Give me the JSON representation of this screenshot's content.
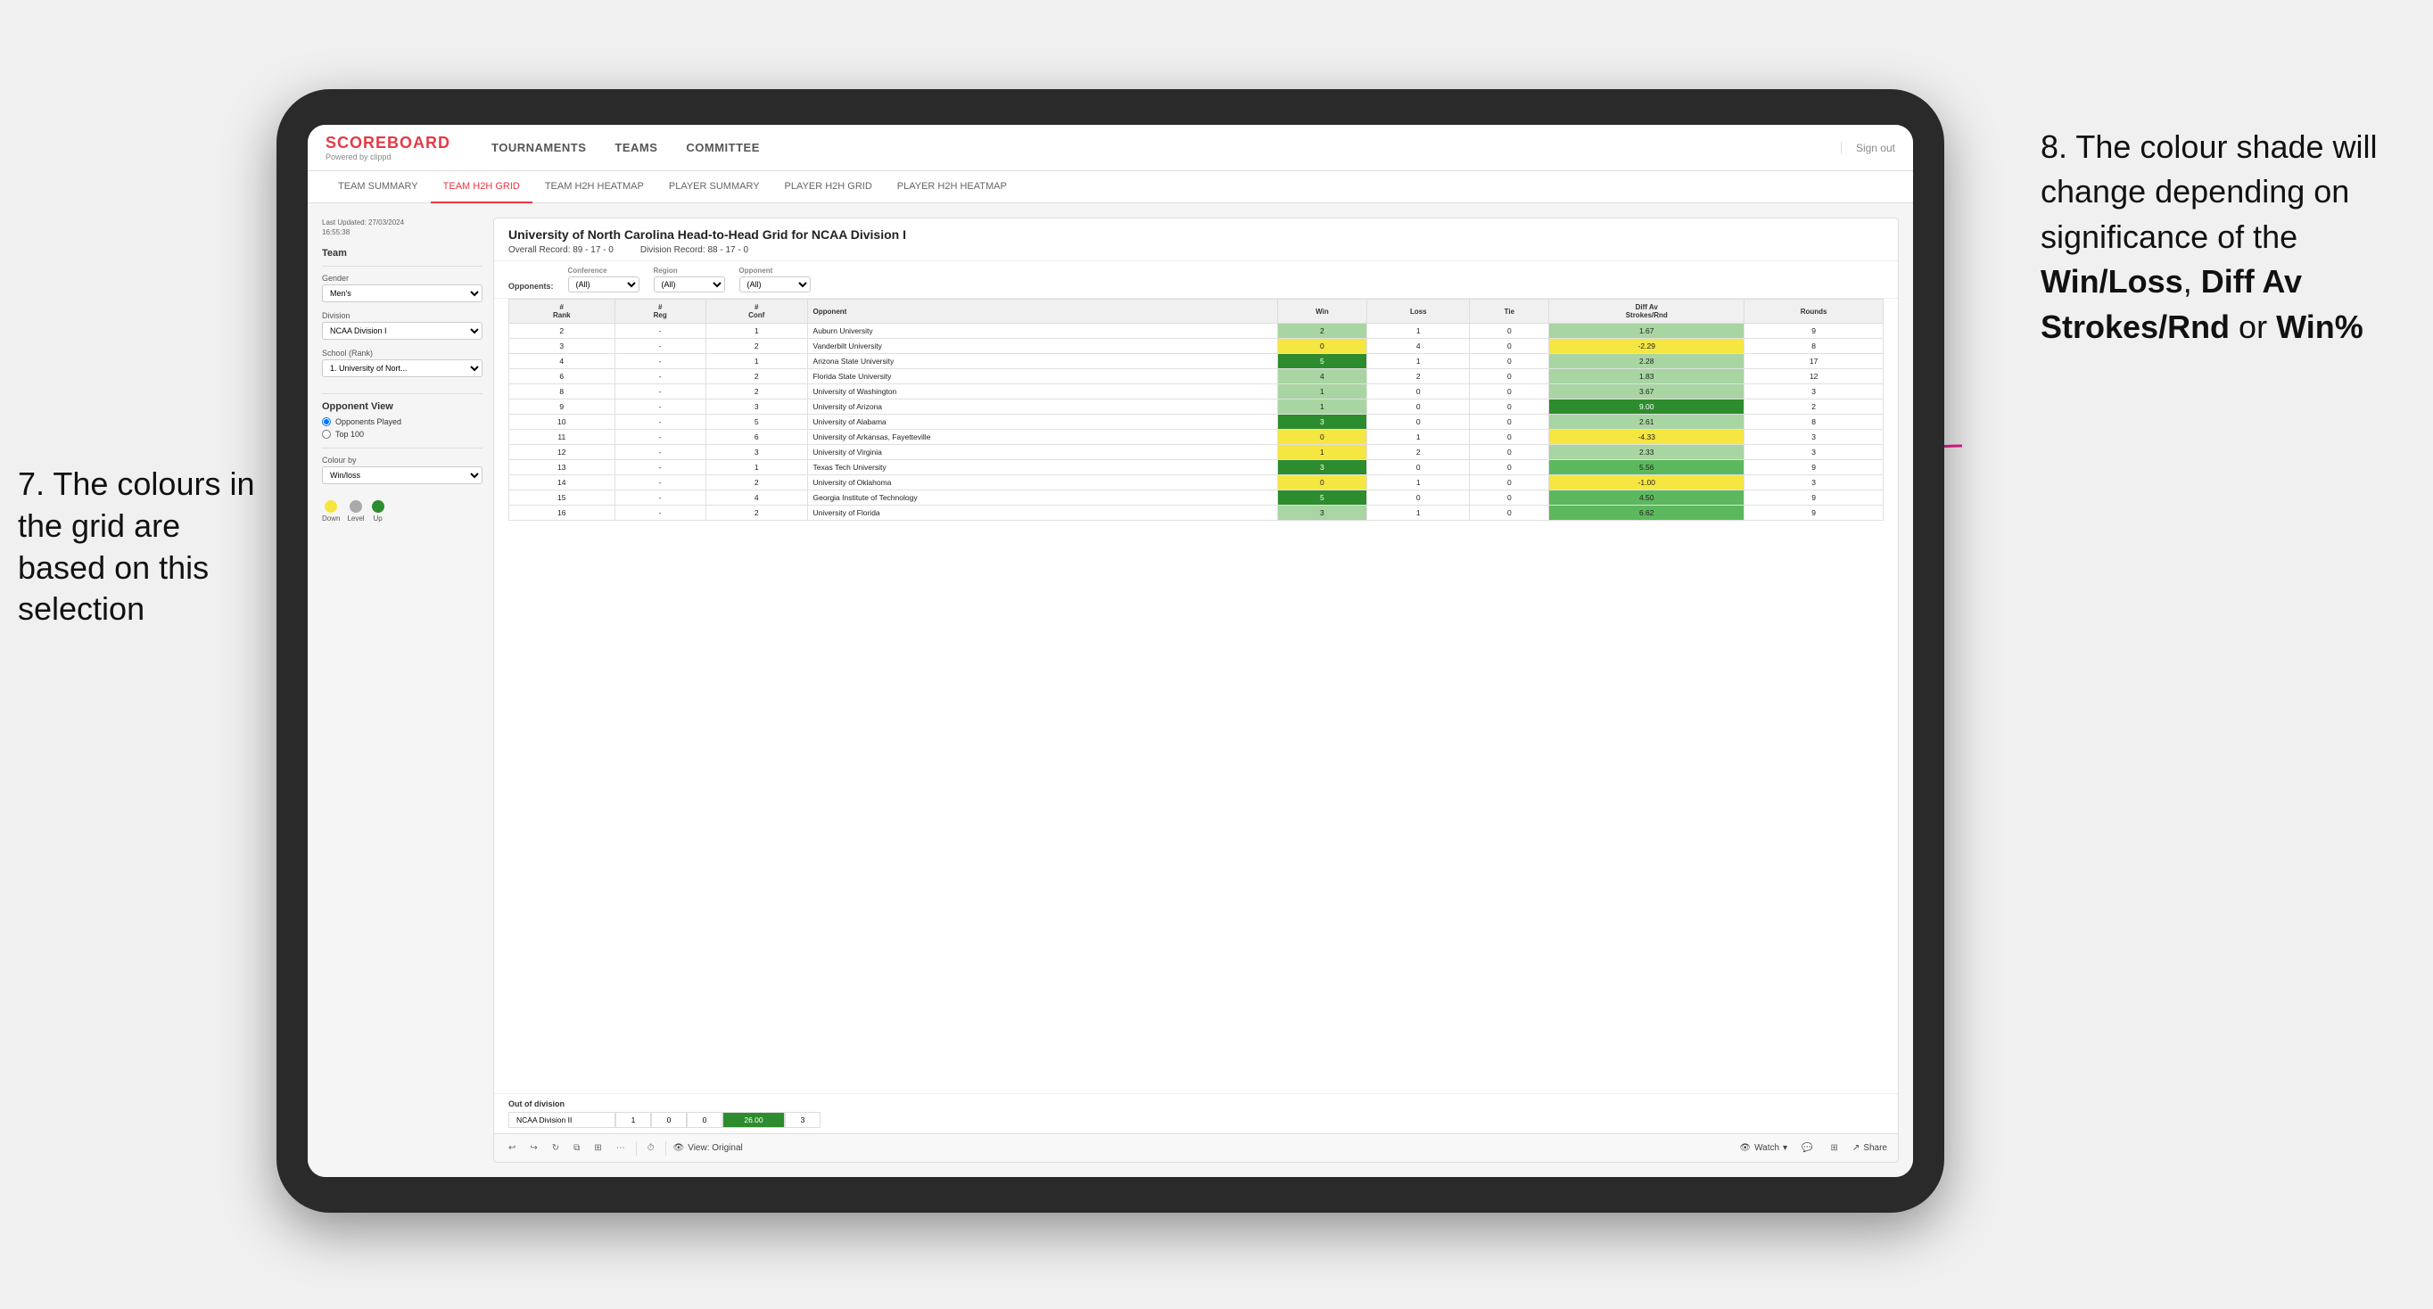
{
  "app": {
    "logo": "SCOREBOARD",
    "logo_sub": "Powered by clippd",
    "nav": [
      "TOURNAMENTS",
      "TEAMS",
      "COMMITTEE"
    ],
    "sign_out": "Sign out",
    "sub_nav": [
      "TEAM SUMMARY",
      "TEAM H2H GRID",
      "TEAM H2H HEATMAP",
      "PLAYER SUMMARY",
      "PLAYER H2H GRID",
      "PLAYER H2H HEATMAP"
    ],
    "active_sub_nav": "TEAM H2H GRID"
  },
  "left_panel": {
    "timestamp_label": "Last Updated: 27/03/2024",
    "timestamp_time": "16:55:38",
    "team_label": "Team",
    "gender_label": "Gender",
    "gender_value": "Men's",
    "division_label": "Division",
    "division_value": "NCAA Division I",
    "school_label": "School (Rank)",
    "school_value": "1. University of Nort...",
    "opponent_view_label": "Opponent View",
    "radio_options": [
      "Opponents Played",
      "Top 100"
    ],
    "selected_radio": "Opponents Played",
    "colour_by_label": "Colour by",
    "colour_by_value": "Win/loss",
    "legend": [
      {
        "label": "Down",
        "color": "#f5e642"
      },
      {
        "label": "Level",
        "color": "#aaaaaa"
      },
      {
        "label": "Up",
        "color": "#2d8c2d"
      }
    ]
  },
  "grid": {
    "title": "University of North Carolina Head-to-Head Grid for NCAA Division I",
    "overall_record_label": "Overall Record:",
    "overall_record": "89 - 17 - 0",
    "division_record_label": "Division Record:",
    "division_record": "88 - 17 - 0",
    "filters": {
      "opponents_label": "Opponents:",
      "conference_label": "Conference",
      "conference_value": "(All)",
      "region_label": "Region",
      "region_value": "(All)",
      "opponent_label": "Opponent",
      "opponent_value": "(All)"
    },
    "columns": [
      "#\nRank",
      "# Reg",
      "# Conf",
      "Opponent",
      "Win",
      "Loss",
      "Tie",
      "Diff Av\nStrokes/Rnd",
      "Rounds"
    ],
    "rows": [
      {
        "rank": "2",
        "reg": "-",
        "conf": "1",
        "opponent": "Auburn University",
        "win": "2",
        "loss": "1",
        "tie": "0",
        "diff": "1.67",
        "rounds": "9",
        "win_color": "green-light",
        "diff_color": "green-light"
      },
      {
        "rank": "3",
        "reg": "-",
        "conf": "2",
        "opponent": "Vanderbilt University",
        "win": "0",
        "loss": "4",
        "tie": "0",
        "diff": "-2.29",
        "rounds": "8",
        "win_color": "yellow",
        "diff_color": "yellow"
      },
      {
        "rank": "4",
        "reg": "-",
        "conf": "1",
        "opponent": "Arizona State University",
        "win": "5",
        "loss": "1",
        "tie": "0",
        "diff": "2.28",
        "rounds": "17",
        "win_color": "green-dark",
        "diff_color": "green-light"
      },
      {
        "rank": "6",
        "reg": "-",
        "conf": "2",
        "opponent": "Florida State University",
        "win": "4",
        "loss": "2",
        "tie": "0",
        "diff": "1.83",
        "rounds": "12",
        "win_color": "green-light",
        "diff_color": "green-light"
      },
      {
        "rank": "8",
        "reg": "-",
        "conf": "2",
        "opponent": "University of Washington",
        "win": "1",
        "loss": "0",
        "tie": "0",
        "diff": "3.67",
        "rounds": "3",
        "win_color": "green-light",
        "diff_color": "green-light"
      },
      {
        "rank": "9",
        "reg": "-",
        "conf": "3",
        "opponent": "University of Arizona",
        "win": "1",
        "loss": "0",
        "tie": "0",
        "diff": "9.00",
        "rounds": "2",
        "win_color": "green-light",
        "diff_color": "green-dark"
      },
      {
        "rank": "10",
        "reg": "-",
        "conf": "5",
        "opponent": "University of Alabama",
        "win": "3",
        "loss": "0",
        "tie": "0",
        "diff": "2.61",
        "rounds": "8",
        "win_color": "green-dark",
        "diff_color": "green-light"
      },
      {
        "rank": "11",
        "reg": "-",
        "conf": "6",
        "opponent": "University of Arkansas, Fayetteville",
        "win": "0",
        "loss": "1",
        "tie": "0",
        "diff": "-4.33",
        "rounds": "3",
        "win_color": "yellow",
        "diff_color": "yellow"
      },
      {
        "rank": "12",
        "reg": "-",
        "conf": "3",
        "opponent": "University of Virginia",
        "win": "1",
        "loss": "2",
        "tie": "0",
        "diff": "2.33",
        "rounds": "3",
        "win_color": "yellow",
        "diff_color": "green-light"
      },
      {
        "rank": "13",
        "reg": "-",
        "conf": "1",
        "opponent": "Texas Tech University",
        "win": "3",
        "loss": "0",
        "tie": "0",
        "diff": "5.56",
        "rounds": "9",
        "win_color": "green-dark",
        "diff_color": "green-mid"
      },
      {
        "rank": "14",
        "reg": "-",
        "conf": "2",
        "opponent": "University of Oklahoma",
        "win": "0",
        "loss": "1",
        "tie": "0",
        "diff": "-1.00",
        "rounds": "3",
        "win_color": "yellow",
        "diff_color": "yellow"
      },
      {
        "rank": "15",
        "reg": "-",
        "conf": "4",
        "opponent": "Georgia Institute of Technology",
        "win": "5",
        "loss": "0",
        "tie": "0",
        "diff": "4.50",
        "rounds": "9",
        "win_color": "green-dark",
        "diff_color": "green-mid"
      },
      {
        "rank": "16",
        "reg": "-",
        "conf": "2",
        "opponent": "University of Florida",
        "win": "3",
        "loss": "1",
        "tie": "0",
        "diff": "6.62",
        "rounds": "9",
        "win_color": "green-light",
        "diff_color": "green-mid"
      }
    ],
    "out_of_division": {
      "label": "Out of division",
      "rows": [
        {
          "name": "NCAA Division II",
          "win": "1",
          "loss": "0",
          "tie": "0",
          "diff": "26.00",
          "rounds": "3",
          "diff_color": "green-dark"
        }
      ]
    }
  },
  "toolbar": {
    "view_label": "View: Original",
    "watch_label": "Watch",
    "share_label": "Share"
  },
  "annotations": {
    "left": "7. The colours in the grid are based on this selection",
    "right_line1": "8. The colour shade will change depending on significance of the ",
    "right_bold1": "Win/Loss",
    "right_sep1": ", ",
    "right_bold2": "Diff Av Strokes/Rnd",
    "right_sep2": " or ",
    "right_bold3": "Win%"
  }
}
